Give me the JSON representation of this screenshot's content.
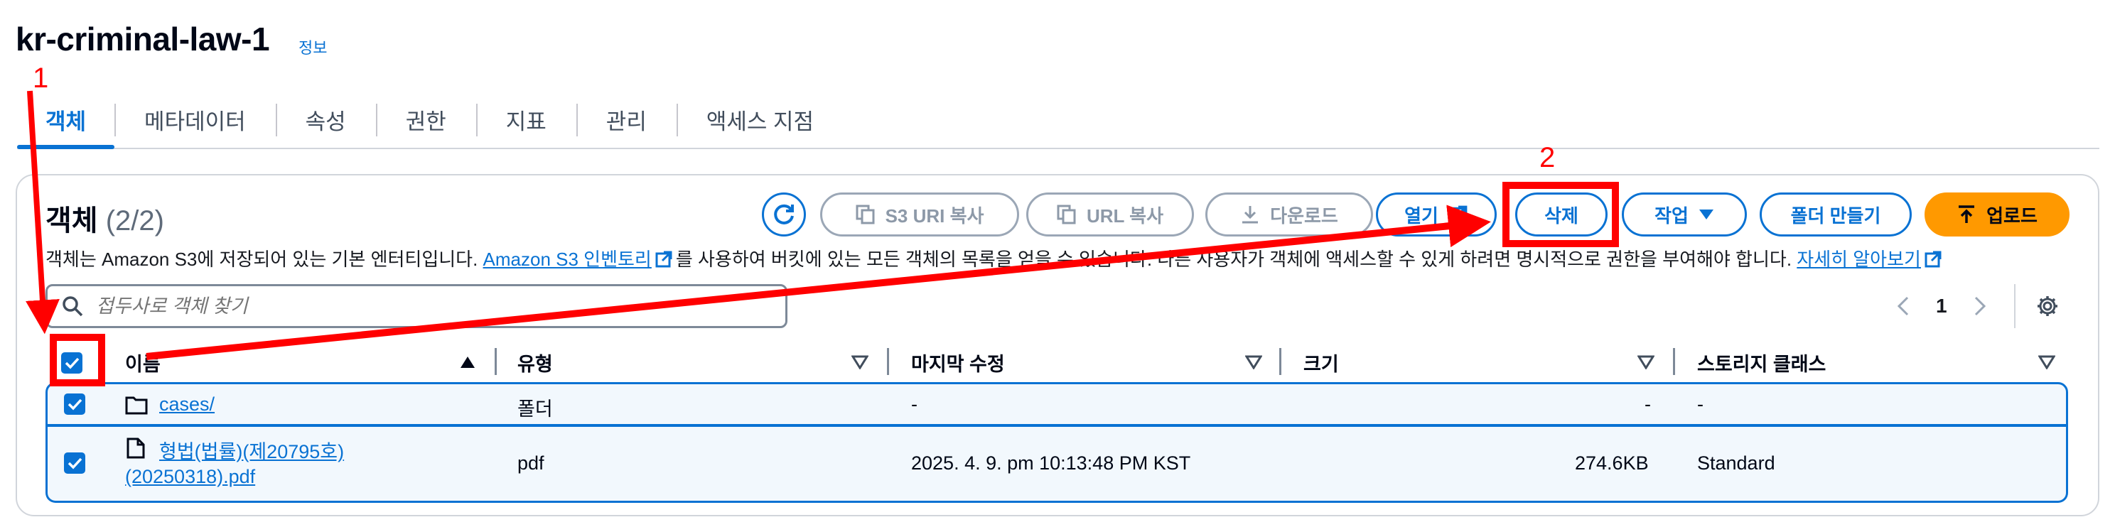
{
  "bucket": {
    "name": "kr-criminal-law-1",
    "info_label": "정보"
  },
  "tabs": [
    {
      "label": "객체",
      "active": true
    },
    {
      "label": "메타데이터"
    },
    {
      "label": "속성"
    },
    {
      "label": "권한"
    },
    {
      "label": "지표"
    },
    {
      "label": "관리"
    },
    {
      "label": "액세스 지점"
    }
  ],
  "objects": {
    "title": "객체",
    "count": "(2/2)",
    "description": {
      "part1": "객체는 Amazon S3에 저장되어 있는 기본 엔터티입니다. ",
      "link1": "Amazon S3 인벤토리",
      "part2": "를 사용하여 버킷에 있는 모든 객체의 목록을 얻을 수 있습니다. 다른 사용자가 객체에 액세스할 수 있게 하려면 명시적으로 권한을 부여해야 합니다. ",
      "link2": "자세히 알아보기"
    }
  },
  "toolbar": {
    "copy_s3_uri": "S3 URI 복사",
    "copy_url": "URL 복사",
    "download": "다운로드",
    "open": "열기",
    "delete": "삭제",
    "actions": "작업",
    "create_folder": "폴더 만들기",
    "upload": "업로드"
  },
  "search": {
    "placeholder": "접두사로 객체 찾기"
  },
  "pagination": {
    "current_page": "1"
  },
  "table": {
    "columns": [
      "이름",
      "유형",
      "마지막 수정",
      "크기",
      "스토리지 클래스"
    ],
    "rows": [
      {
        "name": "cases/",
        "type": "폴더",
        "modified": "-",
        "size": "-",
        "storage": "-",
        "icon": "folder-icon",
        "selected": true
      },
      {
        "name_line1": "형법(법률)(제20795호)",
        "name_line2": "(20250318).pdf",
        "type": "pdf",
        "modified": "2025. 4. 9. pm 10:13:48 PM KST",
        "size": "274.6KB",
        "storage": "Standard",
        "icon": "file-icon",
        "selected": true
      }
    ]
  },
  "annotations": {
    "step1": "1",
    "step2": "2",
    "color": "#ff0000"
  },
  "colors": {
    "accent": "#0972d3",
    "primary": "#ff9900",
    "text": "#000716"
  }
}
